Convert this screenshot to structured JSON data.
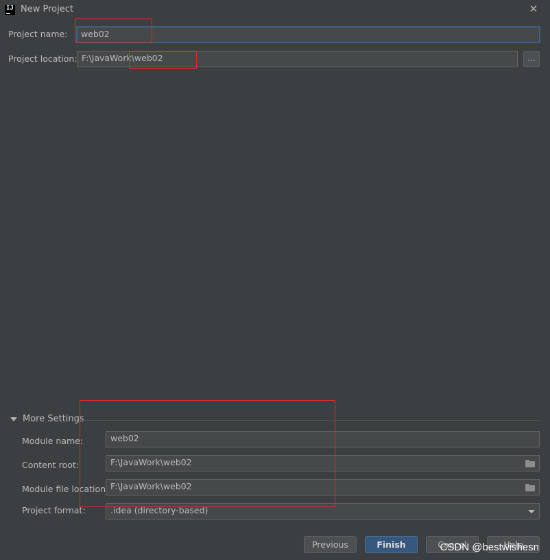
{
  "window": {
    "title": "New Project",
    "app_icon_text": "IJ"
  },
  "form": {
    "project_name_label": "Project name:",
    "project_name_value": "web02",
    "project_location_label": "Project location:",
    "project_location_value": "F:\\JavaWork\\web02",
    "browse_label": "..."
  },
  "more_settings": {
    "title": "More Settings",
    "module_name_label": "Module name:",
    "module_name_value": "web02",
    "content_root_label": "Content root:",
    "content_root_value": "F:\\JavaWork\\web02",
    "module_file_location_label": "Module file location:",
    "module_file_location_value": "F:\\JavaWork\\web02",
    "project_format_label": "Project format:",
    "project_format_value": ".idea (directory-based)"
  },
  "buttons": {
    "previous": "Previous",
    "finish": "Finish",
    "cancel": "Cancel",
    "help": "Help"
  },
  "watermark": "CSDN @bestwishesn",
  "colors": {
    "background": "#3c3f41",
    "field_bg": "#45494a",
    "focus_border": "#3d6185",
    "primary_button": "#365880",
    "annotation_red": "#e22b2b"
  }
}
